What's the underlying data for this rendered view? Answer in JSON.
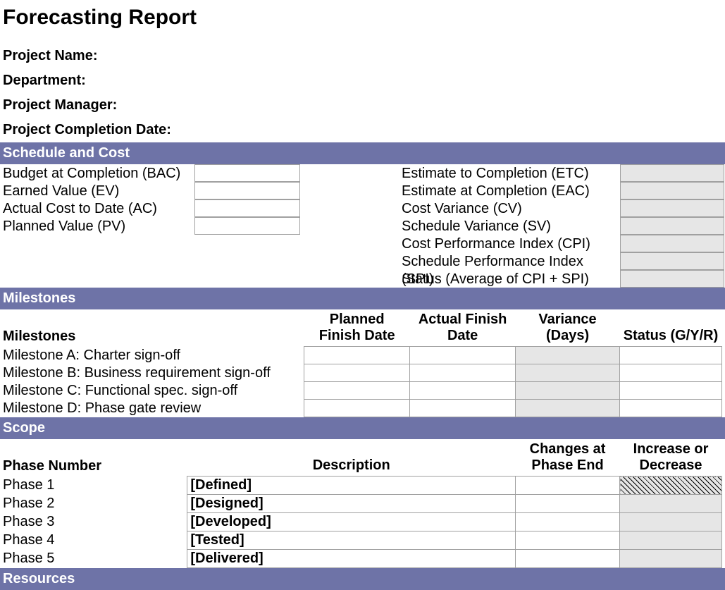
{
  "title": "Forecasting Report",
  "meta": {
    "project_name_label": "Project Name:",
    "department_label": "Department:",
    "project_manager_label": "Project Manager:",
    "project_completion_date_label": "Project Completion Date:"
  },
  "sections": {
    "schedule_cost": "Schedule and Cost",
    "milestones": "Milestones",
    "scope": "Scope",
    "resources": "Resources"
  },
  "schedule_cost": {
    "left": {
      "bac": "Budget at Completion (BAC)",
      "ev": "Earned Value (EV)",
      "ac": "Actual Cost to Date (AC)",
      "pv": "Planned Value (PV)"
    },
    "right": {
      "etc": "Estimate to Completion (ETC)",
      "eac": "Estimate at Completion (EAC)",
      "cv": "Cost Variance (CV)",
      "sv": "Schedule Variance (SV)",
      "cpi": "Cost Performance Index (CPI)",
      "spi": "Schedule Performance Index (SPI)",
      "status": "Status (Average of CPI + SPI)"
    }
  },
  "milestones": {
    "head": {
      "name": "Milestones",
      "planned": "Planned Finish Date",
      "actual": "Actual Finish Date",
      "variance": "Variance (Days)",
      "status": "Status (G/Y/R)"
    },
    "rows": [
      {
        "name": "Milestone A: Charter sign-off"
      },
      {
        "name": "Milestone B: Business requirement sign-off"
      },
      {
        "name": "Milestone C: Functional spec. sign-off"
      },
      {
        "name": "Milestone D: Phase gate review"
      }
    ]
  },
  "scope": {
    "head": {
      "phase": "Phase Number",
      "desc": "Description",
      "changes": "Changes at Phase End",
      "incdec": "Increase or Decrease"
    },
    "rows": [
      {
        "phase": "Phase 1",
        "desc": "[Defined]"
      },
      {
        "phase": "Phase 2",
        "desc": "[Designed]"
      },
      {
        "phase": "Phase 3",
        "desc": "[Developed]"
      },
      {
        "phase": "Phase 4",
        "desc": "[Tested]"
      },
      {
        "phase": "Phase 5",
        "desc": "[Delivered]"
      }
    ]
  }
}
